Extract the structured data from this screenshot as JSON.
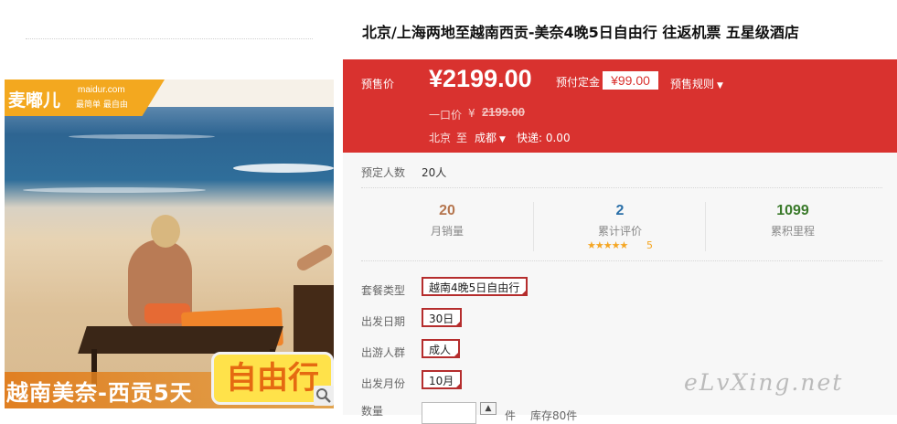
{
  "gallery": {
    "brand_name": "麦嘟儿",
    "brand_url": "maidur.com",
    "brand_slogan": "最简单 最自由",
    "caption": "越南美奈-西贡5天",
    "badge": "自由行",
    "zoom_icon": "magnifier-icon"
  },
  "product": {
    "title": "北京/上海两地至越南西贡-美奈4晚5日自由行 往返机票 五星级酒店"
  },
  "price_panel": {
    "presale_label": "预售价",
    "price": "¥2199.00",
    "deposit_label": "预付定金",
    "deposit_value": "¥99.00",
    "rules_label": "预售规则",
    "one_price_label": "一口价",
    "one_price_currency": "¥",
    "original_price": "2199.00",
    "from_city": "北京",
    "to_word": "至",
    "to_city": "成都",
    "shipping": "快递: 0.00",
    "colors": {
      "panel_bg": "#d9322f"
    }
  },
  "booking": {
    "reserved_label": "预定人数",
    "reserved_value": "20人"
  },
  "stats": [
    {
      "value": "20",
      "label": "月销量",
      "color": "#b5764f"
    },
    {
      "value": "2",
      "label": "累计评价",
      "color": "#2a6fa8",
      "stars": "★★★★★",
      "rating": "5"
    },
    {
      "value": "1099",
      "label": "累积里程",
      "color": "#3a7a2a"
    }
  ],
  "options": [
    {
      "label": "套餐类型",
      "value": "越南4晚5日自由行"
    },
    {
      "label": "出发日期",
      "value": "30日"
    },
    {
      "label": "出游人群",
      "value": "成人"
    },
    {
      "label": "出发月份",
      "value": "10月"
    }
  ],
  "quantity": {
    "label": "数量",
    "unit": "件",
    "stock": "库存80件"
  },
  "watermark": "eLvXing.net"
}
